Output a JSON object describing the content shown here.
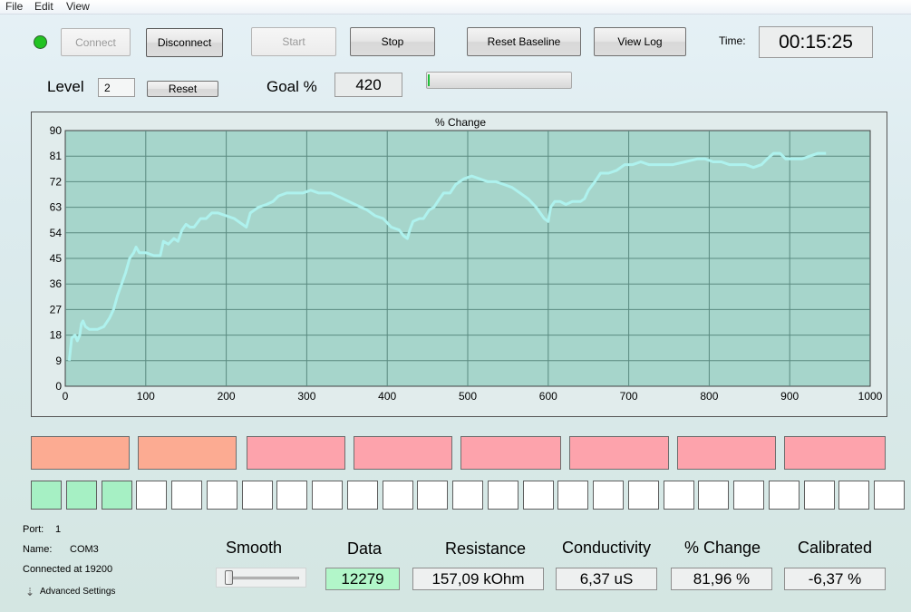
{
  "menu": [
    "File",
    "Edit",
    "View"
  ],
  "toolbar": {
    "connect": "Connect",
    "disconnect": "Disconnect",
    "start": "Start",
    "stop": "Stop",
    "reset_baseline": "Reset Baseline",
    "view_log": "View Log",
    "time_label": "Time:",
    "time_value": "00:15:25",
    "status_color": "#22c322"
  },
  "row2": {
    "level_label": "Level",
    "level_value": "2",
    "reset": "Reset",
    "goal_label": "Goal %",
    "goal_value": "420",
    "progress_fraction": 0.01
  },
  "chart_data": {
    "type": "line",
    "title": "% Change",
    "xlabel": "",
    "ylabel": "",
    "xlim": [
      0,
      1000
    ],
    "ylim": [
      0,
      90
    ],
    "xticks": [
      "0",
      "100",
      "200",
      "300",
      "400",
      "500",
      "600",
      "700",
      "800",
      "900",
      "1000"
    ],
    "yticks": [
      "0",
      "9",
      "18",
      "27",
      "36",
      "45",
      "54",
      "63",
      "72",
      "81",
      "90"
    ],
    "grid": true,
    "line_color": "#aef2ee",
    "plot_bg": "#a6d5cb",
    "points": [
      [
        5,
        9
      ],
      [
        8,
        17
      ],
      [
        12,
        18
      ],
      [
        15,
        16
      ],
      [
        18,
        18
      ],
      [
        20,
        22
      ],
      [
        22,
        23
      ],
      [
        25,
        21
      ],
      [
        30,
        20
      ],
      [
        40,
        20
      ],
      [
        48,
        21
      ],
      [
        55,
        24
      ],
      [
        60,
        27
      ],
      [
        65,
        32
      ],
      [
        70,
        36
      ],
      [
        75,
        40
      ],
      [
        80,
        45
      ],
      [
        85,
        47
      ],
      [
        88,
        49
      ],
      [
        92,
        47
      ],
      [
        100,
        47
      ],
      [
        110,
        46
      ],
      [
        118,
        46
      ],
      [
        122,
        51
      ],
      [
        128,
        50
      ],
      [
        135,
        52
      ],
      [
        140,
        51
      ],
      [
        145,
        55
      ],
      [
        150,
        57
      ],
      [
        155,
        56
      ],
      [
        160,
        56
      ],
      [
        168,
        59
      ],
      [
        175,
        59
      ],
      [
        182,
        61
      ],
      [
        190,
        61
      ],
      [
        200,
        60
      ],
      [
        210,
        59
      ],
      [
        220,
        57
      ],
      [
        225,
        56
      ],
      [
        230,
        61
      ],
      [
        235,
        62
      ],
      [
        240,
        63
      ],
      [
        250,
        64
      ],
      [
        258,
        65
      ],
      [
        265,
        67
      ],
      [
        275,
        68
      ],
      [
        285,
        68
      ],
      [
        295,
        68
      ],
      [
        305,
        69
      ],
      [
        315,
        68
      ],
      [
        330,
        68
      ],
      [
        345,
        66
      ],
      [
        360,
        64
      ],
      [
        375,
        62
      ],
      [
        385,
        60
      ],
      [
        395,
        59
      ],
      [
        405,
        56
      ],
      [
        415,
        55
      ],
      [
        420,
        53
      ],
      [
        425,
        52
      ],
      [
        428,
        55
      ],
      [
        432,
        58
      ],
      [
        440,
        59
      ],
      [
        445,
        59
      ],
      [
        452,
        62
      ],
      [
        458,
        63
      ],
      [
        465,
        66
      ],
      [
        470,
        68
      ],
      [
        478,
        68
      ],
      [
        485,
        71
      ],
      [
        495,
        73
      ],
      [
        505,
        74
      ],
      [
        515,
        73
      ],
      [
        525,
        72
      ],
      [
        535,
        72
      ],
      [
        545,
        71
      ],
      [
        555,
        70
      ],
      [
        565,
        68
      ],
      [
        575,
        66
      ],
      [
        585,
        63
      ],
      [
        595,
        59
      ],
      [
        600,
        58
      ],
      [
        603,
        63
      ],
      [
        608,
        65
      ],
      [
        615,
        65
      ],
      [
        622,
        64
      ],
      [
        630,
        65
      ],
      [
        640,
        65
      ],
      [
        645,
        66
      ],
      [
        650,
        69
      ],
      [
        658,
        72
      ],
      [
        665,
        75
      ],
      [
        675,
        75
      ],
      [
        685,
        76
      ],
      [
        695,
        78
      ],
      [
        705,
        78
      ],
      [
        715,
        79
      ],
      [
        725,
        78
      ],
      [
        740,
        78
      ],
      [
        755,
        78
      ],
      [
        770,
        79
      ],
      [
        785,
        80
      ],
      [
        795,
        80
      ],
      [
        805,
        79
      ],
      [
        815,
        79
      ],
      [
        825,
        78
      ],
      [
        835,
        78
      ],
      [
        845,
        78
      ],
      [
        855,
        77
      ],
      [
        865,
        78
      ],
      [
        872,
        80
      ],
      [
        880,
        82
      ],
      [
        888,
        82
      ],
      [
        895,
        80
      ],
      [
        905,
        80
      ],
      [
        915,
        80
      ],
      [
        925,
        81
      ],
      [
        935,
        82
      ],
      [
        945,
        82
      ]
    ]
  },
  "progress_boxes": [
    {
      "color": "#fcab92"
    },
    {
      "color": "#fcab92"
    },
    {
      "color": "#fda3ac"
    },
    {
      "color": "#fda3ac"
    },
    {
      "color": "#fda3ac"
    },
    {
      "color": "#fda3ac"
    },
    {
      "color": "#fda3ac"
    },
    {
      "color": "#fda3ac"
    }
  ],
  "squares": {
    "total": 25,
    "filled": 3,
    "fill_color": "#a6f0c4",
    "empty_color": "#ffffff"
  },
  "port_info": {
    "port_label": "Port:",
    "port_value": "1",
    "name_label": "Name:",
    "name_value": "COM3",
    "connected": "Connected at 19200",
    "advanced": "Advanced Settings"
  },
  "smooth": {
    "label": "Smooth",
    "value": 0.0
  },
  "metrics": [
    {
      "label": "Data",
      "value": "12279",
      "bg": "#b2f6c9"
    },
    {
      "label": "Resistance",
      "value": "157,09 kOhm",
      "bg": "#eef0f0"
    },
    {
      "label": "Conductivity",
      "value": "6,37 uS",
      "bg": "#eef0f0"
    },
    {
      "label": "% Change",
      "value": "81,96 %",
      "bg": "#eef0f0"
    },
    {
      "label": "Calibrated",
      "value": "-6,37 %",
      "bg": "#eef0f0"
    }
  ]
}
